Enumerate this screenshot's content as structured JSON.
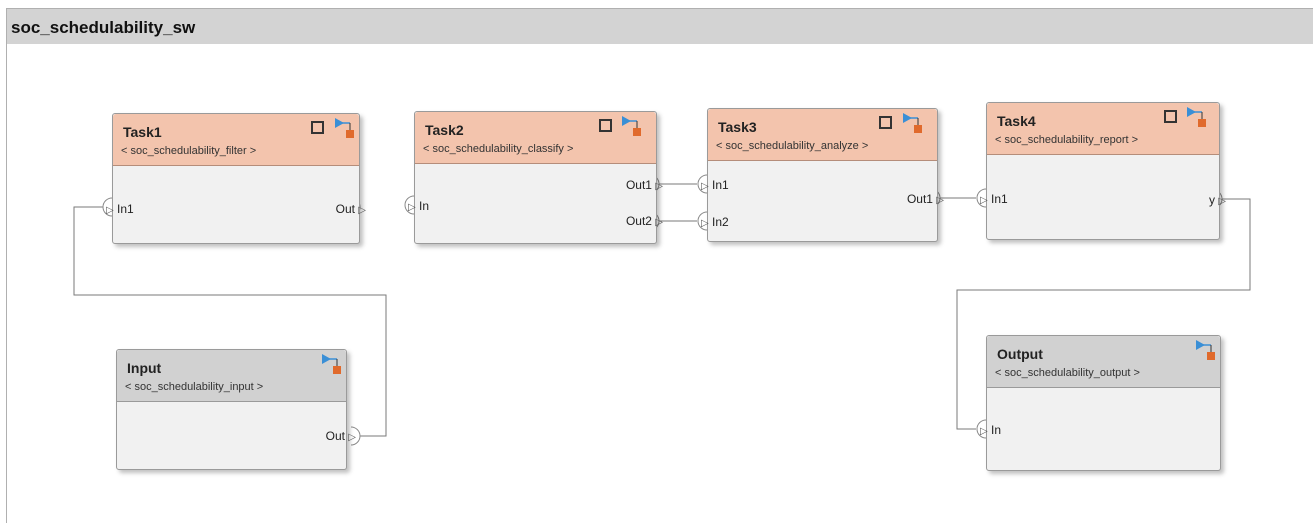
{
  "diagram": {
    "title": "soc_schedulability_sw"
  },
  "blocks": {
    "task1": {
      "name": "Task1",
      "reference": "< soc_schedulability_filter >",
      "inputs": [
        "In1"
      ],
      "outputs": [
        "Out"
      ]
    },
    "task2": {
      "name": "Task2",
      "reference": "< soc_schedulability_classify >",
      "inputs": [
        "In"
      ],
      "outputs": [
        "Out1",
        "Out2"
      ]
    },
    "task3": {
      "name": "Task3",
      "reference": "< soc_schedulability_analyze >",
      "inputs": [
        "In1",
        "In2"
      ],
      "outputs": [
        "Out1"
      ]
    },
    "task4": {
      "name": "Task4",
      "reference": "< soc_schedulability_report >",
      "inputs": [
        "In1"
      ],
      "outputs": [
        "y"
      ]
    },
    "input": {
      "name": "Input",
      "reference": "< soc_schedulability_input >",
      "outputs": [
        "Out"
      ]
    },
    "output": {
      "name": "Output",
      "reference": "< soc_schedulability_output >",
      "inputs": [
        "In"
      ]
    }
  },
  "colors": {
    "task_header": "#f3c4ad",
    "io_header": "#d1d1d1",
    "block_body": "#f1f1f1",
    "processor_icon_blue": "#3a8fd6",
    "processor_icon_orange": "#e06a2c"
  },
  "icons": {
    "task_square": "square-icon",
    "processor": "processor-mapping-icon",
    "port": "triangle-right-icon"
  }
}
